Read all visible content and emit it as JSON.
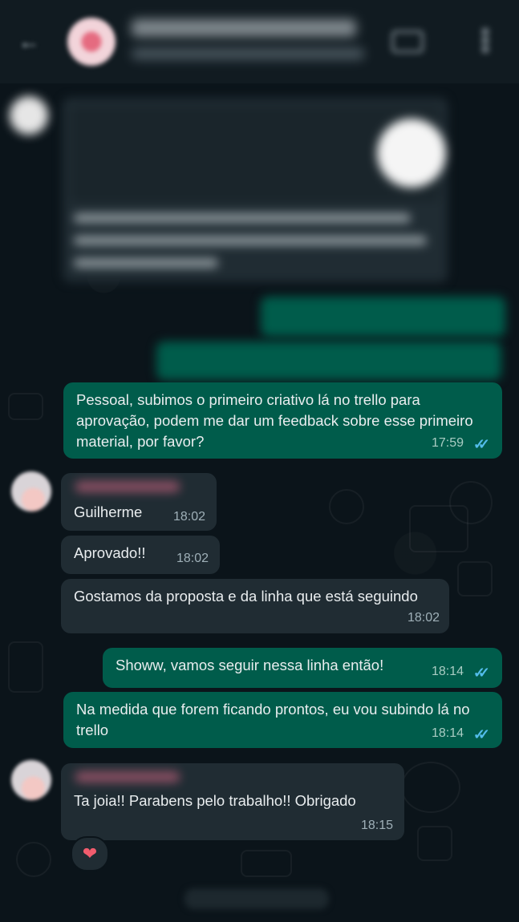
{
  "messages": [
    {
      "text": "Pessoal, subimos o primeiro criativo lá no trello para aprovação, podem me dar um feedback sobre esse primeiro material, por favor?",
      "time": "17:59",
      "direction": "out"
    },
    {
      "text": "Guilherme",
      "time": "18:02",
      "direction": "in"
    },
    {
      "text": "Aprovado!!",
      "time": "18:02",
      "direction": "in"
    },
    {
      "text": "Gostamos da proposta e da linha que está seguindo",
      "time": "18:02",
      "direction": "in"
    },
    {
      "text": "Showw, vamos seguir nessa linha então!",
      "time": "18:14",
      "direction": "out"
    },
    {
      "text": "Na medida que forem ficando prontos, eu vou subindo lá no trello",
      "time": "18:14",
      "direction": "out"
    },
    {
      "text": "Ta joia!! Parabens pelo trabalho!! Obrigado",
      "time": "18:15",
      "direction": "in"
    }
  ],
  "reaction": {
    "emoji": "❤"
  },
  "colors": {
    "incoming": "#202c33",
    "outgoing": "#005c4b",
    "read_ticks": "#53bdeb",
    "background": "#0b141a"
  },
  "icons": {
    "read_receipt": "double-check-icon",
    "back": "back-arrow-icon",
    "video": "video-call-icon",
    "menu": "more-vert-icon"
  }
}
